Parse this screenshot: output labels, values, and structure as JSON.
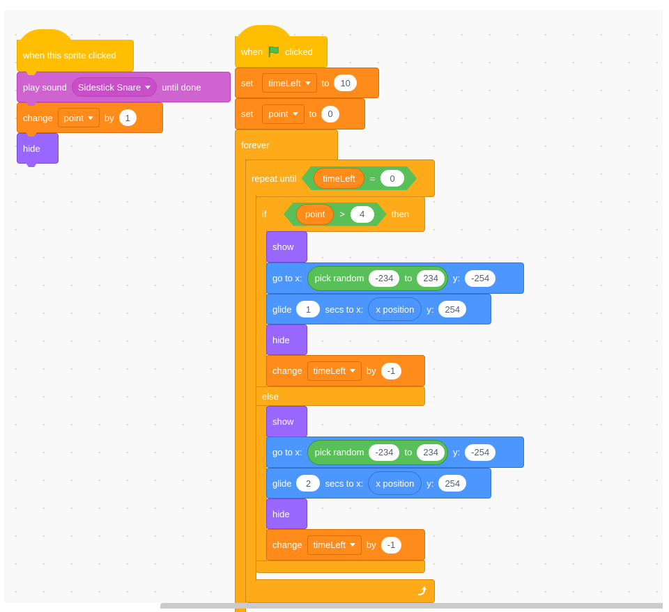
{
  "colors": {
    "events": "#ffbf00",
    "sound": "#cf63cf",
    "variables": "#ff8c1a",
    "control": "#ffab19",
    "looks": "#9966ff",
    "motion": "#4c97ff",
    "operators": "#59c059",
    "canvas": "#f9f9f9"
  },
  "scripts": {
    "sprite_clicked": {
      "hat": "when this sprite clicked",
      "play_sound": {
        "label": "play sound",
        "sound": "Sidestick Snare",
        "suffix": "until done"
      },
      "change_point": {
        "label": "change",
        "variable": "point",
        "by": "by",
        "value": "1"
      },
      "hide": "hide"
    },
    "flag_clicked": {
      "hat": {
        "when": "when",
        "icon": "green-flag-icon",
        "clicked": "clicked"
      },
      "set_timeleft": {
        "label": "set",
        "variable": "timeLeft",
        "to": "to",
        "value": "10"
      },
      "set_point": {
        "label": "set",
        "variable": "point",
        "to": "to",
        "value": "0"
      },
      "forever": "forever",
      "repeat_until": {
        "label": "repeat until",
        "left": "timeLeft",
        "op": "=",
        "right": "0"
      },
      "if": {
        "label": "if",
        "left": "point",
        "op": ">",
        "right": "4",
        "then": "then"
      },
      "then_branch": {
        "show": "show",
        "goto": {
          "label": "go to x:",
          "random": "pick random",
          "from": "-234",
          "to": "to",
          "to_val": "234",
          "y_label": "y:",
          "y": "-254"
        },
        "glide": {
          "label": "glide",
          "secs": "1",
          "secs_label": "secs to x:",
          "x": "x position",
          "y_label": "y:",
          "y": "254"
        },
        "hide": "hide",
        "change": {
          "label": "change",
          "variable": "timeLeft",
          "by": "by",
          "value": "-1"
        }
      },
      "else": "else",
      "else_branch": {
        "show": "show",
        "goto": {
          "label": "go to x:",
          "random": "pick random",
          "from": "-234",
          "to": "to",
          "to_val": "234",
          "y_label": "y:",
          "y": "-254"
        },
        "glide": {
          "label": "glide",
          "secs": "2",
          "secs_label": "secs to x:",
          "x": "x position",
          "y_label": "y:",
          "y": "254"
        },
        "hide": "hide",
        "change": {
          "label": "change",
          "variable": "timeLeft",
          "by": "by",
          "value": "-1"
        }
      },
      "loop_arrow_icon": "loop-arrow-icon"
    }
  }
}
